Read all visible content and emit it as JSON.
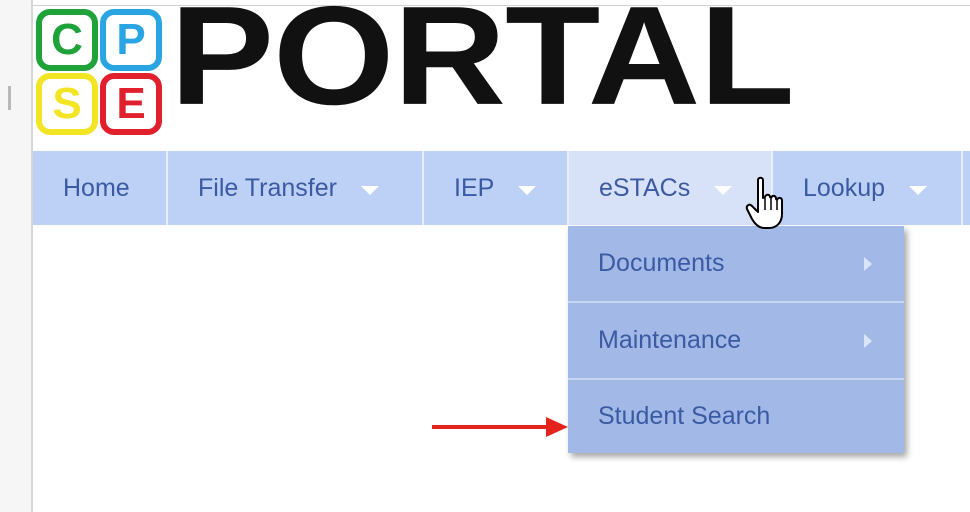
{
  "logo": {
    "letters": [
      "C",
      "P",
      "S",
      "E"
    ],
    "colors": {
      "c": "#1fa23a",
      "p": "#2aa5e3",
      "s": "#f4e524",
      "e": "#e0202c"
    }
  },
  "title": "PORTAL",
  "nav": {
    "items": [
      {
        "label": "Home",
        "has_caret": false
      },
      {
        "label": "File Transfer",
        "has_caret": true
      },
      {
        "label": "IEP",
        "has_caret": true
      },
      {
        "label": "eSTACs",
        "has_caret": true,
        "active": true
      },
      {
        "label": "Lookup",
        "has_caret": true
      }
    ]
  },
  "dropdown": {
    "items": [
      {
        "label": "Documents",
        "has_submenu": true
      },
      {
        "label": "Maintenance",
        "has_submenu": true
      },
      {
        "label": "Student Search",
        "has_submenu": false
      }
    ]
  },
  "colors": {
    "nav_bg": "#bdd1f6",
    "nav_text": "#3a5aa3",
    "dropdown_bg": "#a2b9e7",
    "annotation_arrow": "#e3231c"
  },
  "icons": {
    "cursor": "hand-pointer-icon",
    "annotation": "red-arrow-icon"
  }
}
